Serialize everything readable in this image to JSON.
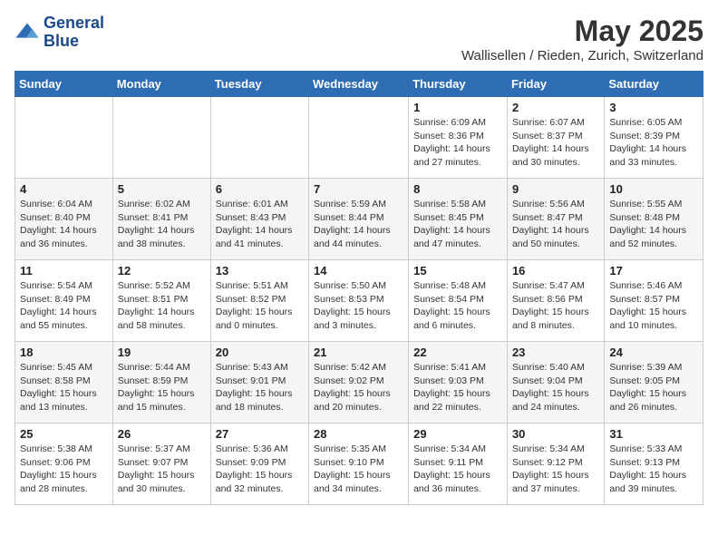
{
  "logo": {
    "line1": "General",
    "line2": "Blue"
  },
  "title": "May 2025",
  "location": "Wallisellen / Rieden, Zurich, Switzerland",
  "weekdays": [
    "Sunday",
    "Monday",
    "Tuesday",
    "Wednesday",
    "Thursday",
    "Friday",
    "Saturday"
  ],
  "weeks": [
    [
      {
        "day": "",
        "info": ""
      },
      {
        "day": "",
        "info": ""
      },
      {
        "day": "",
        "info": ""
      },
      {
        "day": "",
        "info": ""
      },
      {
        "day": "1",
        "info": "Sunrise: 6:09 AM\nSunset: 8:36 PM\nDaylight: 14 hours and 27 minutes."
      },
      {
        "day": "2",
        "info": "Sunrise: 6:07 AM\nSunset: 8:37 PM\nDaylight: 14 hours and 30 minutes."
      },
      {
        "day": "3",
        "info": "Sunrise: 6:05 AM\nSunset: 8:39 PM\nDaylight: 14 hours and 33 minutes."
      }
    ],
    [
      {
        "day": "4",
        "info": "Sunrise: 6:04 AM\nSunset: 8:40 PM\nDaylight: 14 hours and 36 minutes."
      },
      {
        "day": "5",
        "info": "Sunrise: 6:02 AM\nSunset: 8:41 PM\nDaylight: 14 hours and 38 minutes."
      },
      {
        "day": "6",
        "info": "Sunrise: 6:01 AM\nSunset: 8:43 PM\nDaylight: 14 hours and 41 minutes."
      },
      {
        "day": "7",
        "info": "Sunrise: 5:59 AM\nSunset: 8:44 PM\nDaylight: 14 hours and 44 minutes."
      },
      {
        "day": "8",
        "info": "Sunrise: 5:58 AM\nSunset: 8:45 PM\nDaylight: 14 hours and 47 minutes."
      },
      {
        "day": "9",
        "info": "Sunrise: 5:56 AM\nSunset: 8:47 PM\nDaylight: 14 hours and 50 minutes."
      },
      {
        "day": "10",
        "info": "Sunrise: 5:55 AM\nSunset: 8:48 PM\nDaylight: 14 hours and 52 minutes."
      }
    ],
    [
      {
        "day": "11",
        "info": "Sunrise: 5:54 AM\nSunset: 8:49 PM\nDaylight: 14 hours and 55 minutes."
      },
      {
        "day": "12",
        "info": "Sunrise: 5:52 AM\nSunset: 8:51 PM\nDaylight: 14 hours and 58 minutes."
      },
      {
        "day": "13",
        "info": "Sunrise: 5:51 AM\nSunset: 8:52 PM\nDaylight: 15 hours and 0 minutes."
      },
      {
        "day": "14",
        "info": "Sunrise: 5:50 AM\nSunset: 8:53 PM\nDaylight: 15 hours and 3 minutes."
      },
      {
        "day": "15",
        "info": "Sunrise: 5:48 AM\nSunset: 8:54 PM\nDaylight: 15 hours and 6 minutes."
      },
      {
        "day": "16",
        "info": "Sunrise: 5:47 AM\nSunset: 8:56 PM\nDaylight: 15 hours and 8 minutes."
      },
      {
        "day": "17",
        "info": "Sunrise: 5:46 AM\nSunset: 8:57 PM\nDaylight: 15 hours and 10 minutes."
      }
    ],
    [
      {
        "day": "18",
        "info": "Sunrise: 5:45 AM\nSunset: 8:58 PM\nDaylight: 15 hours and 13 minutes."
      },
      {
        "day": "19",
        "info": "Sunrise: 5:44 AM\nSunset: 8:59 PM\nDaylight: 15 hours and 15 minutes."
      },
      {
        "day": "20",
        "info": "Sunrise: 5:43 AM\nSunset: 9:01 PM\nDaylight: 15 hours and 18 minutes."
      },
      {
        "day": "21",
        "info": "Sunrise: 5:42 AM\nSunset: 9:02 PM\nDaylight: 15 hours and 20 minutes."
      },
      {
        "day": "22",
        "info": "Sunrise: 5:41 AM\nSunset: 9:03 PM\nDaylight: 15 hours and 22 minutes."
      },
      {
        "day": "23",
        "info": "Sunrise: 5:40 AM\nSunset: 9:04 PM\nDaylight: 15 hours and 24 minutes."
      },
      {
        "day": "24",
        "info": "Sunrise: 5:39 AM\nSunset: 9:05 PM\nDaylight: 15 hours and 26 minutes."
      }
    ],
    [
      {
        "day": "25",
        "info": "Sunrise: 5:38 AM\nSunset: 9:06 PM\nDaylight: 15 hours and 28 minutes."
      },
      {
        "day": "26",
        "info": "Sunrise: 5:37 AM\nSunset: 9:07 PM\nDaylight: 15 hours and 30 minutes."
      },
      {
        "day": "27",
        "info": "Sunrise: 5:36 AM\nSunset: 9:09 PM\nDaylight: 15 hours and 32 minutes."
      },
      {
        "day": "28",
        "info": "Sunrise: 5:35 AM\nSunset: 9:10 PM\nDaylight: 15 hours and 34 minutes."
      },
      {
        "day": "29",
        "info": "Sunrise: 5:34 AM\nSunset: 9:11 PM\nDaylight: 15 hours and 36 minutes."
      },
      {
        "day": "30",
        "info": "Sunrise: 5:34 AM\nSunset: 9:12 PM\nDaylight: 15 hours and 37 minutes."
      },
      {
        "day": "31",
        "info": "Sunrise: 5:33 AM\nSunset: 9:13 PM\nDaylight: 15 hours and 39 minutes."
      }
    ]
  ]
}
